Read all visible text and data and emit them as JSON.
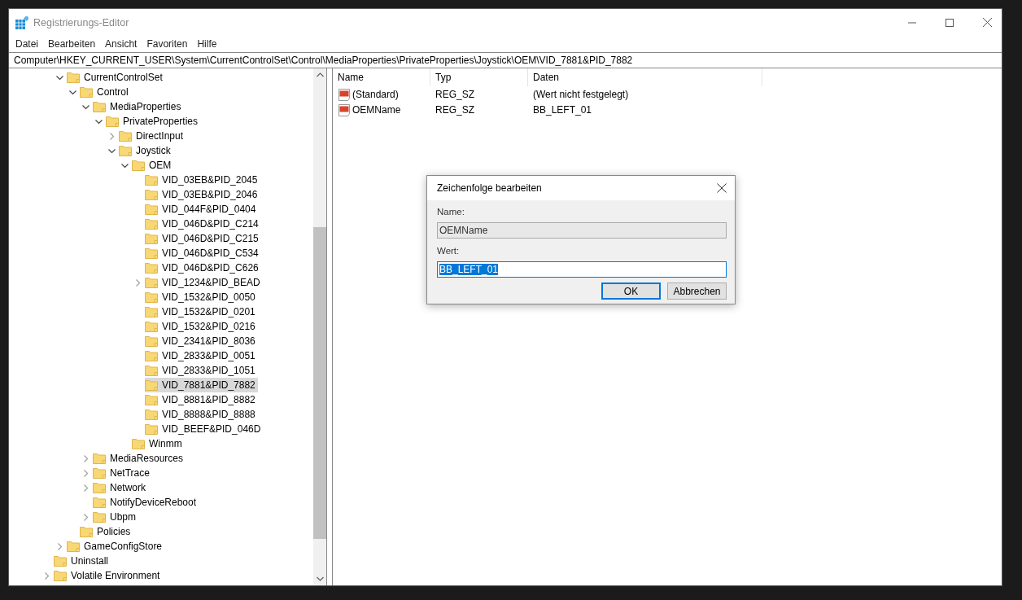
{
  "window": {
    "title": "Registrierungs-Editor"
  },
  "menu": [
    "Datei",
    "Bearbeiten",
    "Ansicht",
    "Favoriten",
    "Hilfe"
  ],
  "address": "Computer\\HKEY_CURRENT_USER\\System\\CurrentControlSet\\Control\\MediaProperties\\PrivateProperties\\Joystick\\OEM\\VID_7881&PID_7882",
  "tree": {
    "items": [
      {
        "children": [
          {
            "label": "CurrentControlSet",
            "expanded": true,
            "selected": false,
            "children": [
              {
                "label": "Control",
                "expanded": true,
                "selected": false,
                "children": [
                  {
                    "label": "MediaProperties",
                    "expanded": true,
                    "selected": false,
                    "children": [
                      {
                        "label": "PrivateProperties",
                        "expanded": true,
                        "selected": false,
                        "children": [
                          {
                            "label": "DirectInput",
                            "expanded": false,
                            "selected": false
                          },
                          {
                            "label": "Joystick",
                            "expanded": true,
                            "selected": false,
                            "children": [
                              {
                                "label": "OEM",
                                "expanded": true,
                                "selected": false,
                                "children": [
                                  {
                                    "label": "VID_03EB&PID_2045",
                                    "selected": false
                                  },
                                  {
                                    "label": "VID_03EB&PID_2046",
                                    "selected": false
                                  },
                                  {
                                    "label": "VID_044F&PID_0404",
                                    "selected": false
                                  },
                                  {
                                    "label": "VID_046D&PID_C214",
                                    "selected": false
                                  },
                                  {
                                    "label": "VID_046D&PID_C215",
                                    "selected": false
                                  },
                                  {
                                    "label": "VID_046D&PID_C534",
                                    "selected": false
                                  },
                                  {
                                    "label": "VID_046D&PID_C626",
                                    "selected": false
                                  },
                                  {
                                    "label": "VID_1234&PID_BEAD",
                                    "expanded": false,
                                    "selected": false
                                  },
                                  {
                                    "label": "VID_1532&PID_0050",
                                    "selected": false
                                  },
                                  {
                                    "label": "VID_1532&PID_0201",
                                    "selected": false
                                  },
                                  {
                                    "label": "VID_1532&PID_0216",
                                    "selected": false
                                  },
                                  {
                                    "label": "VID_2341&PID_8036",
                                    "selected": false
                                  },
                                  {
                                    "label": "VID_2833&PID_0051",
                                    "selected": false
                                  },
                                  {
                                    "label": "VID_2833&PID_1051",
                                    "selected": false
                                  },
                                  {
                                    "label": "VID_7881&PID_7882",
                                    "selected": true
                                  },
                                  {
                                    "label": "VID_8881&PID_8882",
                                    "selected": false
                                  },
                                  {
                                    "label": "VID_8888&PID_8888",
                                    "selected": false
                                  },
                                  {
                                    "label": "VID_BEEF&PID_046D",
                                    "selected": false
                                  }
                                ]
                              },
                              {
                                "label": "Winmm",
                                "selected": false
                              }
                            ]
                          }
                        ]
                      }
                    ]
                  },
                  {
                    "label": "MediaResources",
                    "expanded": false,
                    "selected": false
                  },
                  {
                    "label": "NetTrace",
                    "expanded": false,
                    "selected": false
                  },
                  {
                    "label": "Network",
                    "expanded": false,
                    "selected": false
                  },
                  {
                    "label": "NotifyDeviceReboot",
                    "selected": false
                  },
                  {
                    "label": "Ubpm",
                    "expanded": false,
                    "selected": false
                  }
                ]
              },
              {
                "label": "Policies",
                "selected": false
              }
            ]
          },
          {
            "label": "GameConfigStore",
            "expanded": false,
            "selected": false
          }
        ]
      },
      {
        "label": "Uninstall",
        "selected": false
      },
      {
        "label": "Volatile Environment",
        "expanded": false,
        "selected": false
      }
    ]
  },
  "values": {
    "columns": [
      "Name",
      "Typ",
      "Daten"
    ],
    "rows": [
      {
        "name": "(Standard)",
        "type": "REG_SZ",
        "data": "(Wert nicht festgelegt)"
      },
      {
        "name": "OEMName",
        "type": "REG_SZ",
        "data": "BB_LEFT_01"
      }
    ]
  },
  "dialog": {
    "title": "Zeichenfolge bearbeiten",
    "name_label": "Name:",
    "name_value": "OEMName",
    "value_label": "Wert:",
    "value": "BB_LEFT_01",
    "value_selected": true,
    "buttons": [
      {
        "label": "OK",
        "default": true
      },
      {
        "label": "Abbrechen",
        "default": false
      }
    ]
  }
}
